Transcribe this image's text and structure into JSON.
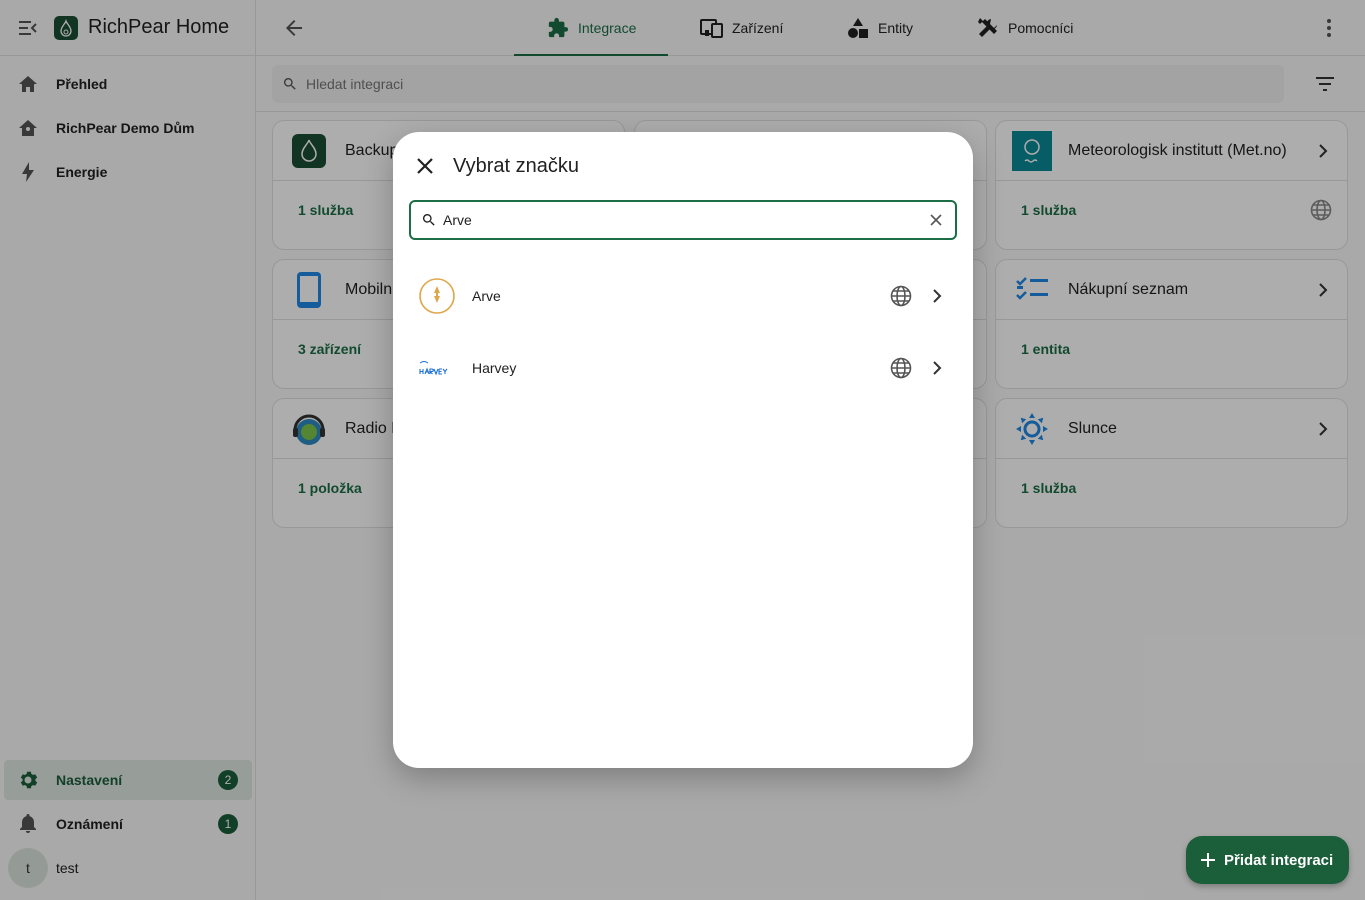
{
  "app": {
    "title": "RichPear Home"
  },
  "sidebar": {
    "items": [
      {
        "label": "Přehled"
      },
      {
        "label": "RichPear Demo Dům"
      },
      {
        "label": "Energie"
      }
    ],
    "bottom": [
      {
        "label": "Nastavení",
        "badge": "2"
      },
      {
        "label": "Oznámení",
        "badge": "1"
      }
    ],
    "user": {
      "initial": "t",
      "name": "test"
    }
  },
  "tabs": [
    {
      "label": "Integrace",
      "icon": "puzzle-icon"
    },
    {
      "label": "Zařízení",
      "icon": "devices-icon"
    },
    {
      "label": "Entity",
      "icon": "shapes-icon"
    },
    {
      "label": "Pomocníci",
      "icon": "tools-icon"
    }
  ],
  "search": {
    "placeholder": "Hledat integraci"
  },
  "cards": [
    {
      "title": "Backup",
      "link": "1 služba"
    },
    {
      "title": "Meteorologisk institutt (Met.no)",
      "link": "1 služba"
    },
    {
      "title": "Mobilní",
      "link": "3 zařízení"
    },
    {
      "title": "Nákupní seznam",
      "link": "1 entita"
    },
    {
      "title": "Radio Browser",
      "link": "1 položka"
    },
    {
      "title": "Slunce",
      "link": "1 služba"
    }
  ],
  "fab": {
    "label": "Přidat integraci"
  },
  "dialog": {
    "title": "Vybrat značku",
    "search_value": "Arve",
    "brands": [
      {
        "name": "Arve"
      },
      {
        "name": "Harvey"
      }
    ]
  },
  "colors": {
    "primary": "#1b6e46",
    "fab": "#1b5e3a",
    "scrim": "rgba(0,0,0,0.32)"
  }
}
